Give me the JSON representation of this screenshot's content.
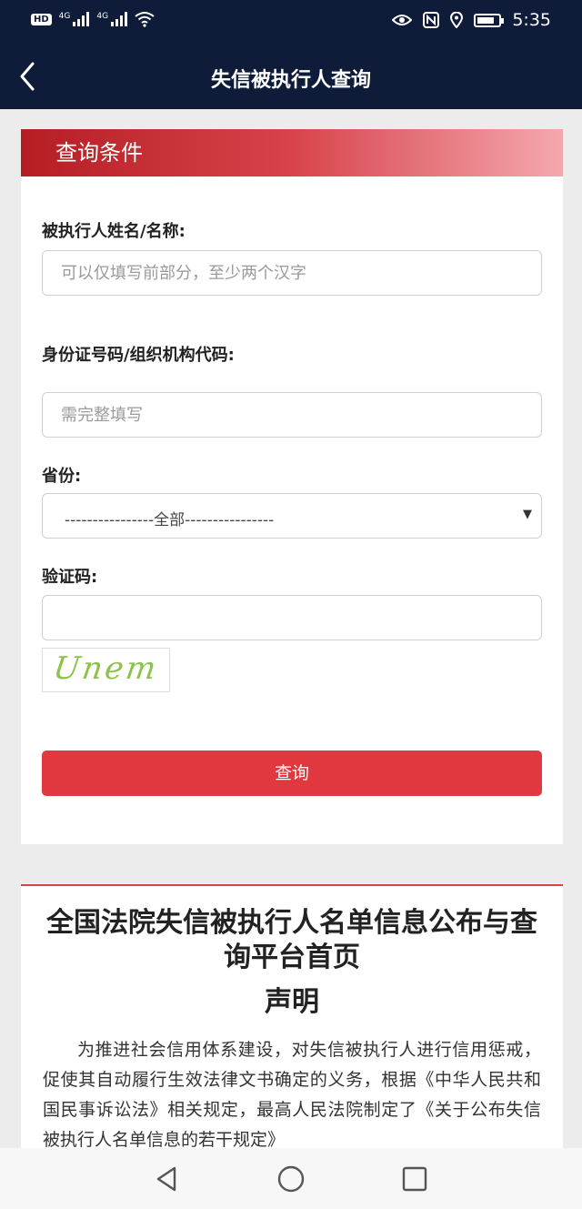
{
  "status_bar": {
    "badge": "HD",
    "net1": "4G",
    "net2": "4G",
    "time": "5:35"
  },
  "nav": {
    "title": "失信被执行人查询"
  },
  "form": {
    "header": "查询条件",
    "name_label": "被执行人姓名/名称:",
    "name_placeholder": "可以仅填写前部分，至少两个汉字",
    "id_label": "身份证号码/组织机构代码:",
    "id_placeholder": "需完整填写",
    "province_label": "省份:",
    "province_value": "----------------全部----------------",
    "captcha_label": "验证码:",
    "captcha_value": "",
    "captcha_image_text": "Unem",
    "submit_label": "查询"
  },
  "notice": {
    "title": "全国法院失信被执行人名单信息公布与查询平台首页",
    "subtitle": "声明",
    "body": "为推进社会信用体系建设，对失信被执行人进行信用惩戒，促使其自动履行生效法律文书确定的义务，根据《中华人民共和国民事诉讼法》相关规定，最高人民法院制定了《关于公布失信被执行人名单信息的若干规定》"
  },
  "icons": {
    "back": "back-chevron-icon",
    "eye": "eye-icon",
    "nfc": "nfc-icon",
    "location": "location-pin-icon",
    "wifi": "wifi-icon",
    "battery": "battery-icon",
    "select_arrow": "dropdown-arrow-icon",
    "nav_back": "nav-back-triangle-icon",
    "nav_home": "nav-home-circle-icon",
    "nav_recent": "nav-recent-square-icon"
  },
  "colors": {
    "navbar": "#0e1c3a",
    "accent": "#e0383e",
    "header_red": "#b51d23"
  }
}
